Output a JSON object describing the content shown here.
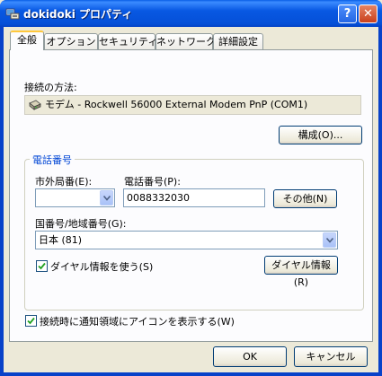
{
  "window": {
    "title": "dokidoki プロパティ",
    "help_label": "?",
    "close_label": "✕"
  },
  "tabs": [
    {
      "label": "全般",
      "active": true
    },
    {
      "label": "オプション",
      "active": false
    },
    {
      "label": "セキュリティ",
      "active": false
    },
    {
      "label": "ネットワーク",
      "active": false
    },
    {
      "label": "詳細設定",
      "active": false
    }
  ],
  "connection": {
    "label": "接続の方法:",
    "device": "モデム - Rockwell 56000 External Modem PnP (COM1)",
    "configure_button": "構成(O)..."
  },
  "phone": {
    "group_title": "電話番号",
    "area_code_label": "市外局番(E):",
    "area_code_value": "",
    "number_label": "電話番号(P):",
    "number_value": "0088332030",
    "other_button": "その他(N)",
    "country_label": "国番号/地域番号(G):",
    "country_value": "日本 (81)",
    "use_dialing_rules_label": "ダイヤル情報を使う(S)",
    "use_dialing_rules_checked": true,
    "dialing_rules_button": "ダイヤル情報(R)"
  },
  "notify": {
    "label": "接続時に通知領域にアイコンを表示する(W)",
    "checked": true
  },
  "footer": {
    "ok_label": "OK",
    "cancel_label": "キャンセル"
  }
}
